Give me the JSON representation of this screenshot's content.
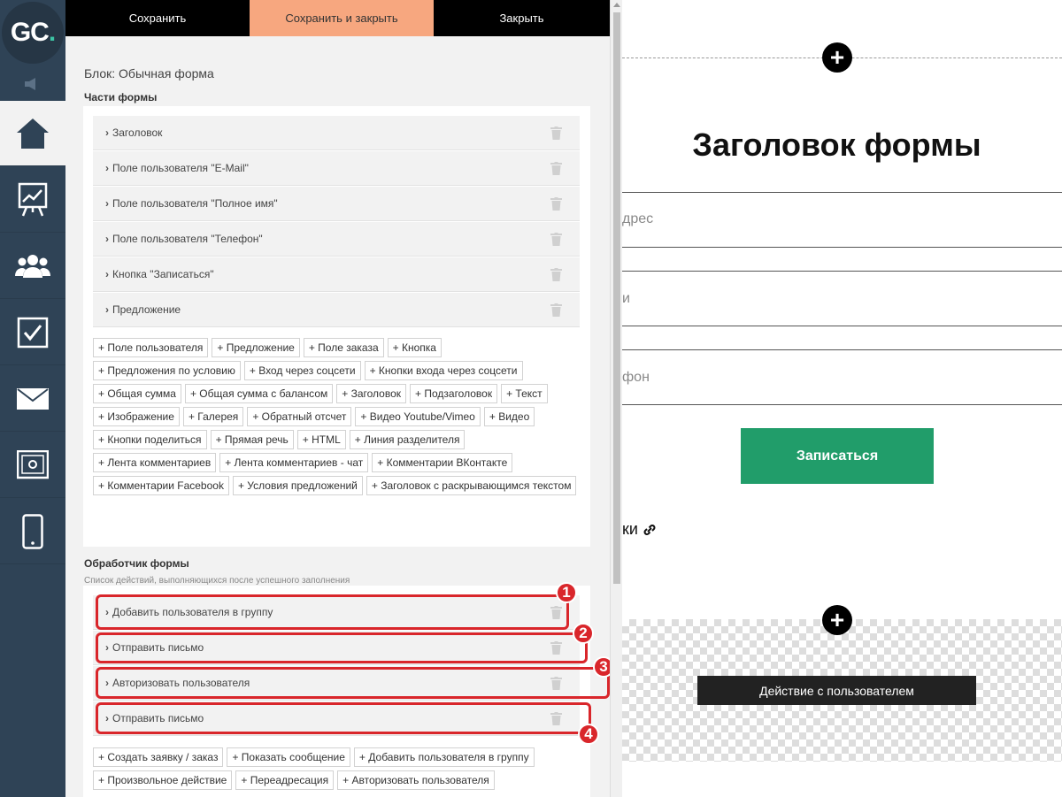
{
  "logo": {
    "text": "GC",
    "dot": "."
  },
  "nav": {
    "items": [
      "home-icon",
      "chart-icon",
      "users-icon",
      "tasks-icon",
      "mail-icon",
      "safe-icon",
      "mobile-icon"
    ]
  },
  "toolbar": {
    "save": "Сохранить",
    "save_close": "Сохранить и закрыть",
    "close": "Закрыть"
  },
  "block": {
    "title": "Блок: Обычная форма"
  },
  "parts": {
    "heading": "Части формы",
    "items": [
      "Заголовок",
      "Поле пользователя \"E-Mail\"",
      "Поле пользователя \"Полное имя\"",
      "Поле пользователя \"Телефон\"",
      "Кнопка \"Записаться\"",
      "Предложение"
    ],
    "add_buttons": [
      "+ Поле пользователя",
      "+ Предложение",
      "+ Поле заказа",
      "+ Кнопка",
      "+ Предложения по условию",
      "+ Вход через соцсети",
      "+ Кнопки входа через соцсети",
      "+ Общая сумма",
      "+ Общая сумма с балансом",
      "+ Заголовок",
      "+ Подзаголовок",
      "+ Текст",
      "+ Изображение",
      "+ Галерея",
      "+ Обратный отсчет",
      "+ Видео Youtube/Vimeo",
      "+ Видео",
      "+ Кнопки поделиться",
      "+ Прямая речь",
      "+ HTML",
      "+ Линия разделителя",
      "+ Лента комментариев",
      "+ Лента комментариев - чат",
      "+ Комментарии ВКонтакте",
      "+ Комментарии Facebook",
      "+ Условия предложений",
      "+ Заголовок с раскрывающимся текстом"
    ]
  },
  "handler": {
    "heading": "Обработчик формы",
    "subtitle": "Список действий, выполняющихся после успешного заполнения",
    "items": [
      "Добавить пользователя в группу",
      "Отправить письмо",
      "Авторизовать пользователя",
      "Отправить письмо"
    ],
    "badges": [
      "1",
      "2",
      "3",
      "4"
    ],
    "add_buttons": [
      "+ Создать заявку / заказ",
      "+ Показать сообщение",
      "+ Добавить пользователя в группу",
      "+ Произвольное действие",
      "+ Переадресация",
      "+ Авторизовать пользователя"
    ]
  },
  "preview": {
    "form_title": "Заголовок формы",
    "field_email_partial": "дрес",
    "field_name_partial": "и",
    "field_phone_partial": "фон",
    "submit_label": "Записаться",
    "text_partial": "ки",
    "action_label": "Действие с пользователем"
  },
  "colors": {
    "accent": "#f7a77f",
    "nav": "#2f4356",
    "submit": "#219d6a",
    "highlight": "#d9262b"
  }
}
